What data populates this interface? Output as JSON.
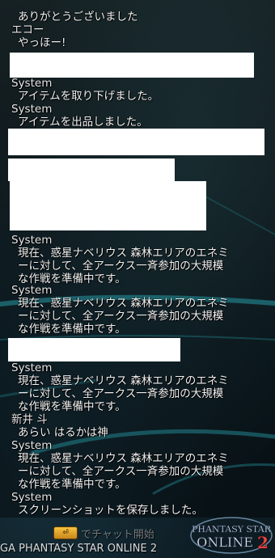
{
  "chat": {
    "lines": [
      {
        "type": "body",
        "text": "ありがとうございました"
      },
      {
        "type": "sender",
        "text": "エコー"
      },
      {
        "type": "body",
        "text": "やっほー!"
      },
      {
        "type": "sender",
        "text": "System"
      },
      {
        "type": "body",
        "text": "アイテムを取り下げました。"
      },
      {
        "type": "sender",
        "text": "System"
      },
      {
        "type": "body",
        "text": "アイテムを出品しました。"
      },
      {
        "type": "sender",
        "text": "System"
      },
      {
        "type": "body",
        "text": "現在、惑星ナベリウス  森林エリアのエネミ"
      },
      {
        "type": "body",
        "text": "ーに対して、全アークス一斉参加の大規模"
      },
      {
        "type": "body",
        "text": "な作戦を準備中です。"
      },
      {
        "type": "sender",
        "text": "System"
      },
      {
        "type": "body",
        "text": "現在、惑星ナベリウス  森林エリアのエネミ"
      },
      {
        "type": "body",
        "text": "ーに対して、全アークス一斉参加の大規模"
      },
      {
        "type": "body",
        "text": "な作戦を準備中です。"
      },
      {
        "type": "sender",
        "text": "System"
      },
      {
        "type": "body",
        "text": "現在、惑星ナベリウス  森林エリアのエネミ"
      },
      {
        "type": "body",
        "text": "ーに対して、全アークス一斉参加の大規模"
      },
      {
        "type": "body",
        "text": "な作戦を準備中です。"
      },
      {
        "type": "sender",
        "text": "新井  斗"
      },
      {
        "type": "body",
        "text": "あらい  はるかは神"
      },
      {
        "type": "sender",
        "text": "System"
      },
      {
        "type": "body",
        "text": "現在、惑星ナベリウス  森林エリアのエネミ"
      },
      {
        "type": "body",
        "text": "ーに対して、全アークス一斉参加の大規模"
      },
      {
        "type": "body",
        "text": "な作戦を準備中です。"
      },
      {
        "type": "sender",
        "text": "System"
      },
      {
        "type": "body",
        "text": "スクリーンショットを保存しました。"
      }
    ]
  },
  "footer": {
    "chat_start_label": "でチャット開始",
    "copyright": "GA PHANTASY STAR ONLINE 2",
    "logo_line1": "PHANTASY STAR",
    "logo_line2": "ONLINE",
    "logo_num": "2"
  },
  "colors": {
    "accent_cyan": "#39d6e6",
    "redaction": "#ffffff"
  }
}
